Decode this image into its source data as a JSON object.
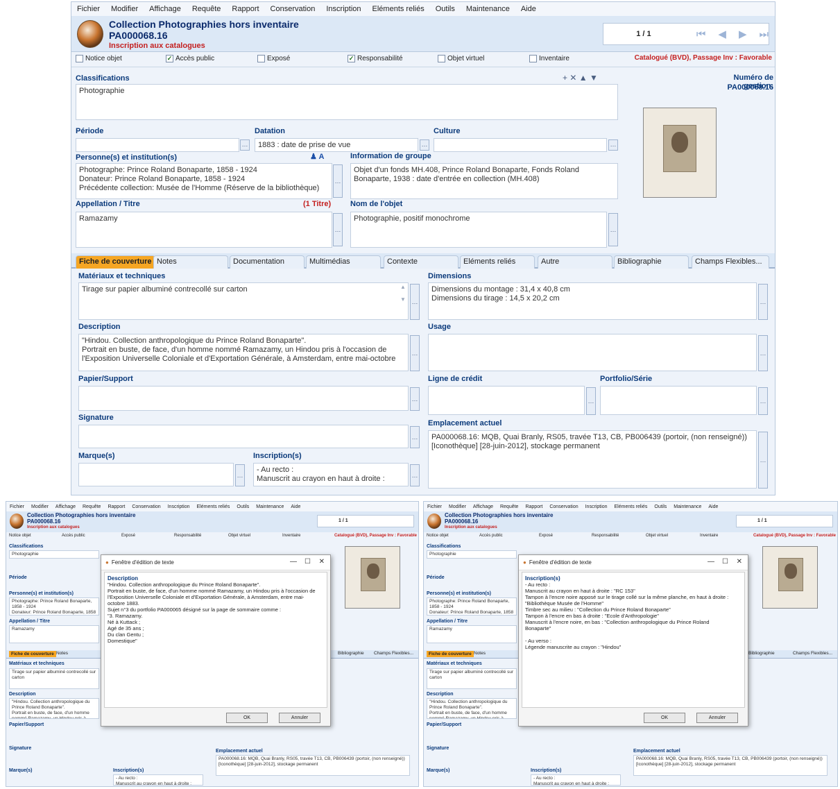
{
  "menu": [
    "Fichier",
    "Modifier",
    "Affichage",
    "Requête",
    "Rapport",
    "Conservation",
    "Inscription",
    "Eléments reliés",
    "Outils",
    "Maintenance",
    "Aide"
  ],
  "header": {
    "title": "Collection Photographies hors inventaire",
    "id": "PA000068.16",
    "subtitle": "Inscription aux catalogues",
    "counter": "1 / 1"
  },
  "checks": {
    "notice": "Notice objet",
    "public": "Accès public",
    "expose": "Exposé",
    "responsabilite": "Responsabilité",
    "virtuel": "Objet virtuel",
    "inventaire": "Inventaire",
    "status": "Catalogué (BVD), Passage Inv : Favorable"
  },
  "classifications": {
    "label": "Classifications",
    "value": "Photographie"
  },
  "gestion": {
    "label": "Numéro de gestion:",
    "value": "PA000068.16"
  },
  "periode": {
    "label": "Période",
    "value": ""
  },
  "datation": {
    "label": "Datation",
    "value": "1883 : date de prise de vue"
  },
  "culture": {
    "label": "Culture",
    "value": ""
  },
  "personnes": {
    "label": "Personne(s) et institution(s)",
    "value": "Photographe: Prince Roland Bonaparte, 1858 - 1924\nDonateur: Prince Roland Bonaparte, 1858 - 1924\nPrécédente collection: Musée de l'Homme (Réserve de la bibliothèque)"
  },
  "groupe": {
    "label": "Information de groupe",
    "value": "Objet d'un fonds MH.408, Prince Roland Bonaparte, Fonds Roland\nBonaparte, 1938 : date d'entrée en collection (MH.408)"
  },
  "appellation": {
    "label": "Appellation / Titre",
    "count": "(1 Titre)",
    "value": "Ramazamy"
  },
  "nom_objet": {
    "label": "Nom de l'objet",
    "value": "Photographie, positif monochrome"
  },
  "tabs": [
    "Fiche de couverture",
    "Notes",
    "Documentation",
    "Multimédias",
    "Contexte",
    "Eléments reliés",
    "Autre",
    "Bibliographie",
    "Champs Flexibles..."
  ],
  "materiaux": {
    "label": "Matériaux et techniques",
    "value": "Tirage sur papier albuminé contrecollé sur carton"
  },
  "dimensions": {
    "label": "Dimensions",
    "value": "Dimensions du montage : 31,4 x 40,8 cm\nDimensions du tirage : 14,5 x 20,2 cm"
  },
  "description": {
    "label": "Description",
    "value": "\"Hindou. Collection anthropologique du Prince Roland Bonaparte\".\nPortrait en buste, de face, d'un homme nommé Ramazamy, un Hindou pris à l'occasion de\nl'Exposition Universelle Coloniale et d'Exportation Générale, à Amsterdam, entre mai-octobre"
  },
  "usage": {
    "label": "Usage",
    "value": ""
  },
  "papier": {
    "label": "Papier/Support",
    "value": ""
  },
  "credit": {
    "label": "Ligne de crédit",
    "value": ""
  },
  "portfolio": {
    "label": "Portfolio/Série",
    "value": ""
  },
  "signature": {
    "label": "Signature",
    "value": ""
  },
  "emplacement": {
    "label": "Emplacement actuel",
    "value": "PA000068.16: MQB, Quai Branly, RS05, travée T13, CB, PB006439 (portoir, (non renseigné))\n[Iconothèque] [28-juin-2012], stockage permanent"
  },
  "marques": {
    "label": "Marque(s)",
    "value": ""
  },
  "inscriptions": {
    "label": "Inscription(s)",
    "value": "- Au recto :\nManuscrit au crayon en haut à droite :"
  },
  "dialog1": {
    "title": "Fenêtre d'édition de texte",
    "heading": "Description",
    "body": "\"Hindou. Collection anthropologique du Prince Roland Bonaparte\".\nPortrait en buste, de face, d'un homme nommé Ramazamy, un Hindou pris à l'occasion de\nl'Exposition Universelle Coloniale et d'Exportation Générale, à Amsterdam, entre mai-\noctobre 1883.\nSujet n°3 du portfolio PA000065 désigné sur la page de sommaire comme :\n\"3. Ramazamy.\nNé à Kuttack ;\nAgé de 35 ans ;\nDu clan Gentu ;\nDomestique\"",
    "ok": "OK",
    "cancel": "Annuler"
  },
  "dialog2": {
    "title": "Fenêtre d'édition de texte",
    "heading": "Inscription(s)",
    "body": "- Au recto :\nManuscrit au crayon en haut à droite : \"RC 153\"\nTampon à l'encre noire apposé sur le tirage collé sur la même planche, en haut à droite :\n\"Bibliothèque Musée de l'Homme\"\nTimbre sec au milieu : \"Collection du Prince Roland Bonaparte\"\nTampon à l'encre en bas à droite : \"Ecole d'Anthropologie\"\nManuscrit à l'encre noire, en bas : \"Collection anthropologique du Prince Roland\nBonaparte\"\n\n- Au verso :\nLégende manuscrite au crayon : \"Hindou\"",
    "ok": "OK",
    "cancel": "Annuler"
  }
}
